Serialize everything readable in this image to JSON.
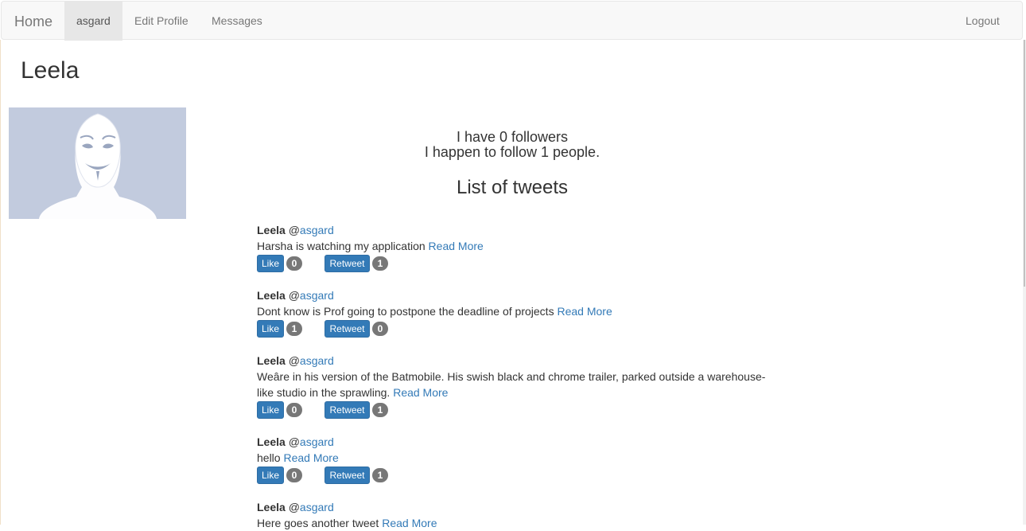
{
  "nav": {
    "brand": "Home",
    "items": [
      {
        "label": "asgard",
        "active": true
      },
      {
        "label": "Edit Profile",
        "active": false
      },
      {
        "label": "Messages",
        "active": false
      }
    ],
    "logout": "Logout"
  },
  "profile": {
    "name": "Leela",
    "followers_text": "I have 0 followers",
    "following_text": "I happen to follow 1 people.",
    "avatar_icon": "anonymous-mask-avatar"
  },
  "tweets_heading": "List of tweets",
  "tweets": [
    {
      "name": "Leela",
      "at": "@",
      "handle": "asgard",
      "text": "Harsha is watching my application",
      "read_more": "Read More",
      "like_label": "Like",
      "likes": "0",
      "retweet_label": "Retweet",
      "retweets": "1"
    },
    {
      "name": "Leela",
      "at": "@",
      "handle": "asgard",
      "text": "Dont know is Prof going to postpone the deadline of projects",
      "read_more": "Read More",
      "like_label": "Like",
      "likes": "1",
      "retweet_label": "Retweet",
      "retweets": "0"
    },
    {
      "name": "Leela",
      "at": "@",
      "handle": "asgard",
      "text": "Weâre in his version of the Batmobile. His swish black and chrome trailer, parked outside a warehouse-like studio in the sprawling.",
      "read_more": "Read More",
      "like_label": "Like",
      "likes": "0",
      "retweet_label": "Retweet",
      "retweets": "1"
    },
    {
      "name": "Leela",
      "at": "@",
      "handle": "asgard",
      "text": "hello",
      "read_more": "Read More",
      "like_label": "Like",
      "likes": "0",
      "retweet_label": "Retweet",
      "retweets": "1"
    },
    {
      "name": "Leela",
      "at": "@",
      "handle": "asgard",
      "text": "Here goes another tweet",
      "read_more": "Read More"
    }
  ],
  "colors": {
    "link": "#337ab7",
    "button": "#337ab7",
    "badge": "#777777",
    "avatar_bg": "#c2cbde",
    "navbar_bg": "#f8f8f8"
  }
}
